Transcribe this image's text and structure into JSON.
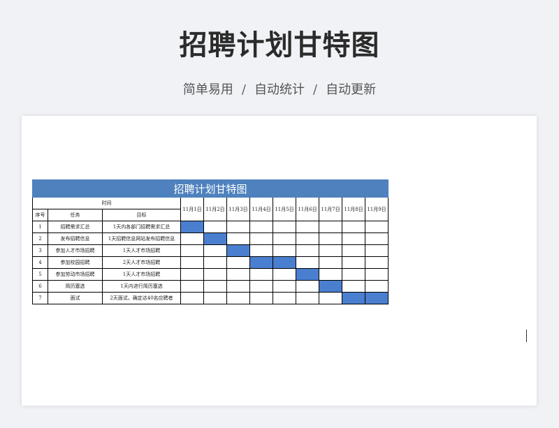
{
  "page": {
    "title": "招聘计划甘特图",
    "subtitle": [
      "简单易用",
      "自动统计",
      "自动更新"
    ],
    "subtitle_separator": "/"
  },
  "sheet": {
    "banner_title": "招聘计划甘特图",
    "time_header": "时间",
    "columns": {
      "seq": "序号",
      "task": "任务",
      "goal": "目标"
    },
    "dates": [
      "11月1日",
      "11月2日",
      "11月3日",
      "11月4日",
      "11月5日",
      "11月6日",
      "11月7日",
      "11月8日",
      "11月9日"
    ],
    "rows": [
      {
        "seq": "1",
        "task": "招聘需求汇总",
        "goal": "1天内各部门招聘需求汇总",
        "active_days": [
          0
        ]
      },
      {
        "seq": "2",
        "task": "发布招聘信息",
        "goal": "1天招聘信息网站发布招聘信息",
        "active_days": [
          1
        ]
      },
      {
        "seq": "3",
        "task": "参加人才市场招聘",
        "goal": "1天人才市场招聘",
        "active_days": [
          2
        ]
      },
      {
        "seq": "4",
        "task": "参加校园招聘",
        "goal": "2天人才市场招聘",
        "active_days": [
          3,
          4
        ]
      },
      {
        "seq": "5",
        "task": "参加劳动市场招聘",
        "goal": "1天人才市场招聘",
        "active_days": [
          5
        ]
      },
      {
        "seq": "6",
        "task": "简历塞选",
        "goal": "1天内进行简历塞选",
        "active_days": [
          6
        ]
      },
      {
        "seq": "7",
        "task": "面试",
        "goal": "2天面试，确定达40名应聘者",
        "active_days": [
          7,
          8
        ]
      }
    ],
    "bar_color": "#4a7fd0",
    "banner_color": "#4e81bd"
  }
}
